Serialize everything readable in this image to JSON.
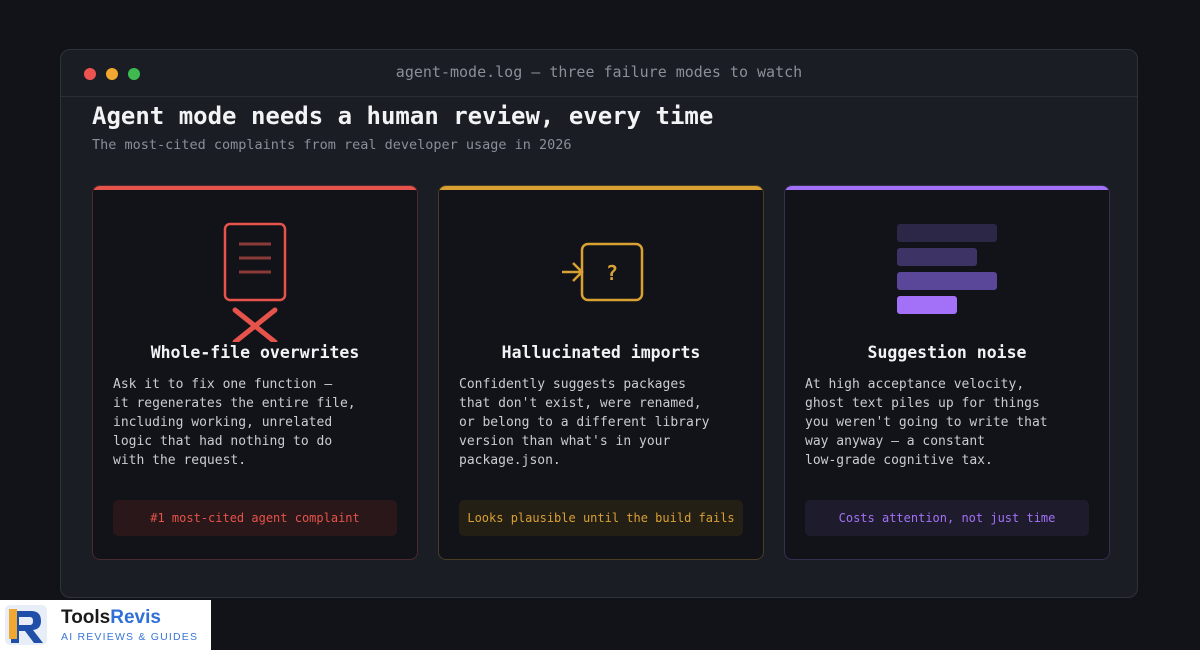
{
  "window": {
    "title": "agent-mode.log — three failure modes to watch"
  },
  "header": {
    "headline": "Agent mode needs a human review, every time",
    "subhead": "The most-cited complaints from real developer usage in 2026"
  },
  "cards": [
    {
      "icon": "document-x-icon",
      "accent": "#e5534b",
      "title": "Whole-file overwrites",
      "description": "Ask it to fix one function —\nit regenerates the entire file,\nincluding working, unrelated\nlogic that had nothing to do\nwith the request.",
      "tag": "#1 most-cited agent complaint"
    },
    {
      "icon": "unknown-import-icon",
      "accent": "#d9a034",
      "title": "Hallucinated imports",
      "description": "Confidently suggests packages\nthat don't exist, were renamed,\nor belong to a different library\nversion than what's in your\npackage.json.",
      "tag": "Looks plausible until the build fails"
    },
    {
      "icon": "stacked-suggestions-icon",
      "accent": "#a371f7",
      "title": "Suggestion noise",
      "description": "At high acceptance velocity,\nghost text piles up for things\nyou weren't going to write that\nway anyway — a constant\nlow-grade cognitive tax.",
      "tag": "Costs attention, not just time"
    }
  ],
  "brand": {
    "name_part1": "Tools",
    "name_part2": "Revis",
    "tagline": "AI REVIEWS & GUIDES"
  }
}
